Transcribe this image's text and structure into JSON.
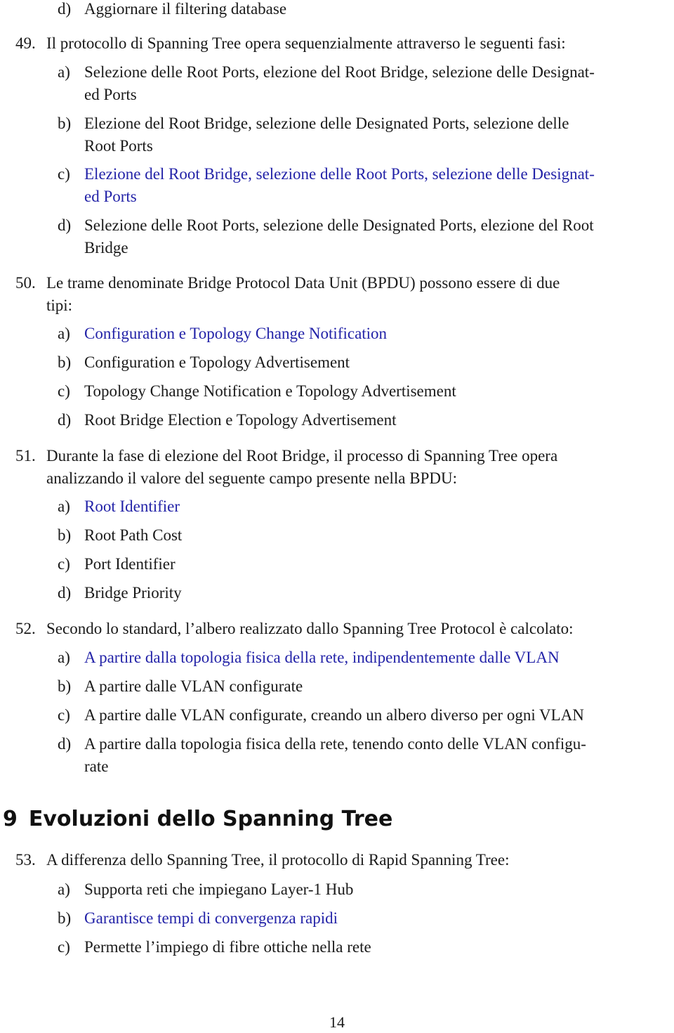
{
  "prev_item": {
    "letter": "d)",
    "text": "Aggiornare il filtering database"
  },
  "questions": [
    {
      "number": "49.",
      "text_lines": [
        "Il protocollo di Spanning Tree opera sequenzialmente attraverso le seguenti fasi:"
      ],
      "options": [
        {
          "letter": "a)",
          "lines": [
            "Selezione delle Root Ports, elezione del Root Bridge, selezione delle Designat-",
            "ed Ports"
          ],
          "correct": false
        },
        {
          "letter": "b)",
          "lines": [
            "Elezione del Root Bridge, selezione delle Designated Ports, selezione delle",
            "Root Ports"
          ],
          "correct": false
        },
        {
          "letter": "c)",
          "lines": [
            "Elezione del Root Bridge, selezione delle Root Ports, selezione delle Designat-",
            "ed Ports"
          ],
          "correct": true
        },
        {
          "letter": "d)",
          "lines": [
            "Selezione delle Root Ports, selezione delle Designated Ports, elezione del Root",
            "Bridge"
          ],
          "correct": false
        }
      ]
    },
    {
      "number": "50.",
      "text_lines": [
        "Le trame denominate Bridge Protocol Data Unit (BPDU) possono essere di due",
        "tipi:"
      ],
      "options": [
        {
          "letter": "a)",
          "lines": [
            "Configuration e Topology Change Notification"
          ],
          "correct": true
        },
        {
          "letter": "b)",
          "lines": [
            "Configuration e Topology Advertisement"
          ],
          "correct": false
        },
        {
          "letter": "c)",
          "lines": [
            "Topology Change Notification e Topology Advertisement"
          ],
          "correct": false
        },
        {
          "letter": "d)",
          "lines": [
            "Root Bridge Election e Topology Advertisement"
          ],
          "correct": false
        }
      ]
    },
    {
      "number": "51.",
      "text_lines": [
        "Durante la fase di elezione del Root Bridge, il processo di Spanning Tree opera",
        "analizzando il valore del seguente campo presente nella BPDU:"
      ],
      "options": [
        {
          "letter": "a)",
          "lines": [
            "Root Identifier"
          ],
          "correct": true
        },
        {
          "letter": "b)",
          "lines": [
            "Root Path Cost"
          ],
          "correct": false
        },
        {
          "letter": "c)",
          "lines": [
            "Port Identifier"
          ],
          "correct": false
        },
        {
          "letter": "d)",
          "lines": [
            "Bridge Priority"
          ],
          "correct": false
        }
      ]
    },
    {
      "number": "52.",
      "text_lines": [
        "Secondo lo standard, l’albero realizzato dallo Spanning Tree Protocol è calcolato:"
      ],
      "options": [
        {
          "letter": "a)",
          "lines": [
            "A partire dalla topologia fisica della rete, indipendentemente dalle VLAN"
          ],
          "correct": true
        },
        {
          "letter": "b)",
          "lines": [
            "A partire dalle VLAN configurate"
          ],
          "correct": false
        },
        {
          "letter": "c)",
          "lines": [
            "A partire dalle VLAN configurate, creando un albero diverso per ogni VLAN"
          ],
          "correct": false
        },
        {
          "letter": "d)",
          "lines": [
            "A partire dalla topologia fisica della rete, tenendo conto delle VLAN configu-",
            "rate"
          ],
          "correct": false
        }
      ]
    }
  ],
  "section": {
    "number": "9",
    "title": "Evoluzioni dello Spanning Tree"
  },
  "questions_after": [
    {
      "number": "53.",
      "text_lines": [
        "A differenza dello Spanning Tree, il protocollo di Rapid Spanning Tree:"
      ],
      "options": [
        {
          "letter": "a)",
          "lines": [
            "Supporta reti che impiegano Layer-1 Hub"
          ],
          "correct": false
        },
        {
          "letter": "b)",
          "lines": [
            "Garantisce tempi di convergenza rapidi"
          ],
          "correct": true
        },
        {
          "letter": "c)",
          "lines": [
            "Permette l’impiego di fibre ottiche nella rete"
          ],
          "correct": false
        }
      ]
    }
  ],
  "page_number": "14",
  "colors": {
    "correct_answer": "#2323a8",
    "text": "#1a1a1a"
  }
}
